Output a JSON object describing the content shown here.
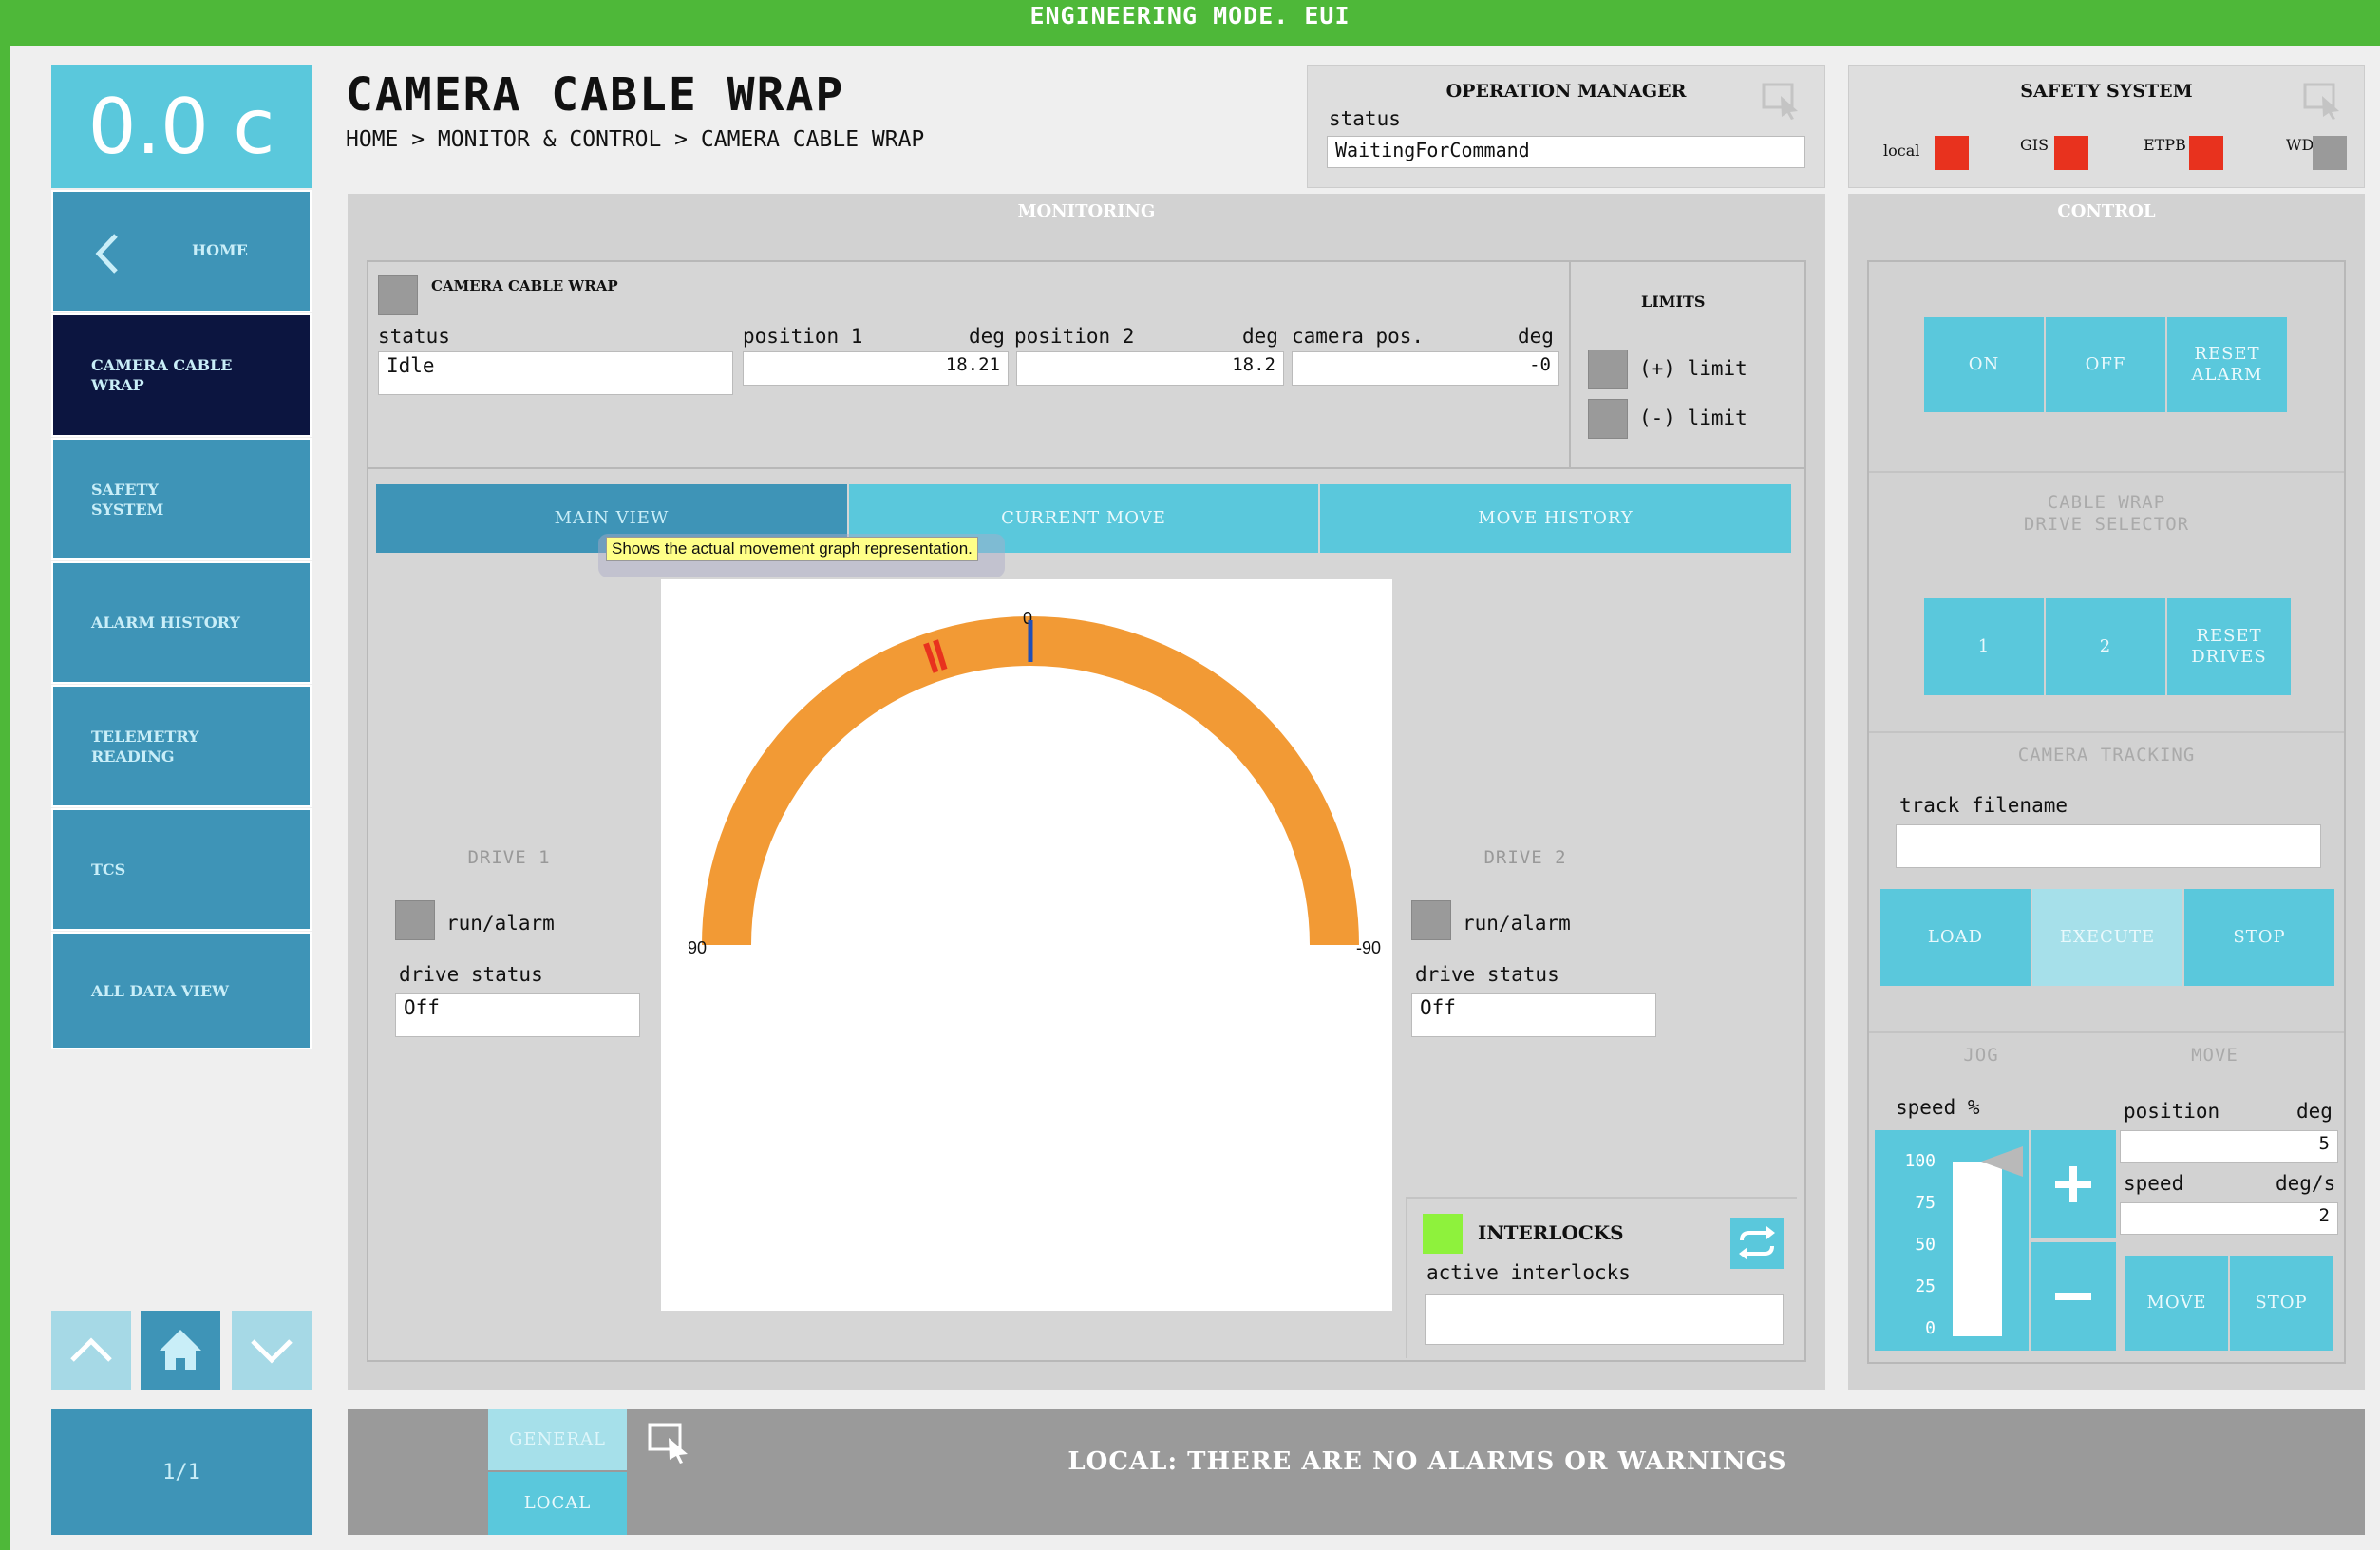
{
  "app": {
    "mode_title": "ENGINEERING MODE. EUI"
  },
  "sidebar": {
    "temperature": "0.0 c",
    "home_label": "HOME",
    "items": [
      {
        "label": "CAMERA CABLE\nWRAP"
      },
      {
        "label": "SAFETY\nSYSTEM"
      },
      {
        "label": "ALARM HISTORY"
      },
      {
        "label": "TELEMETRY\nREADING"
      },
      {
        "label": "TCS"
      },
      {
        "label": "ALL DATA VIEW"
      }
    ],
    "pager": "1/1"
  },
  "header": {
    "title": "CAMERA CABLE WRAP",
    "breadcrumb": "HOME > MONITOR & CONTROL > CAMERA CABLE WRAP"
  },
  "operation_manager": {
    "title": "OPERATION MANAGER",
    "status_label": "status",
    "status_value": "WaitingForCommand"
  },
  "safety_system": {
    "title": "SAFETY SYSTEM",
    "indicators": [
      {
        "label": "local",
        "color": "#e8321e"
      },
      {
        "label": "GIS",
        "color": "#e8321e"
      },
      {
        "label": "ETPB",
        "color": "#e8321e"
      },
      {
        "label": "WD",
        "color": "#9a9a9a"
      }
    ]
  },
  "monitoring": {
    "title": "MONITORING",
    "ccw_title": "CAMERA CABLE WRAP",
    "status_label": "status",
    "status_value": "Idle",
    "position1_label": "position 1",
    "position1_unit": "deg",
    "position1_value": "18.21",
    "position2_label": "position 2",
    "position2_unit": "deg",
    "position2_value": "18.2",
    "camera_pos_label": "camera pos.",
    "camera_pos_unit": "deg",
    "camera_pos_value": "-0",
    "limits_title": "LIMITS",
    "limit_plus": "(+) limit",
    "limit_minus": "(-) limit",
    "tabs": [
      "MAIN VIEW",
      "CURRENT MOVE",
      "MOVE HISTORY"
    ],
    "tooltip": "Shows the actual movement graph representation.",
    "gauge": {
      "label_top": "0",
      "label_left": "90",
      "label_right": "-90",
      "position1_deg": 18.21,
      "position2_deg": 18.2,
      "camera_deg": 0
    },
    "drive1": {
      "title": "DRIVE 1",
      "run_label": "run/alarm",
      "status_label": "drive status",
      "status_value": "Off"
    },
    "drive2": {
      "title": "DRIVE 2",
      "run_label": "run/alarm",
      "status_label": "drive status",
      "status_value": "Off"
    },
    "interlocks": {
      "title": "INTERLOCKS",
      "active_label": "active interlocks",
      "active_value": "",
      "indicator_color": "#8ef23c"
    }
  },
  "control": {
    "title": "CONTROL",
    "power_buttons": [
      "ON",
      "OFF",
      "RESET\nALARM"
    ],
    "drive_selector_title": "CABLE WRAP\nDRIVE SELECTOR",
    "drive_buttons": [
      "1",
      "2",
      "RESET\nDRIVES"
    ],
    "tracking_title": "CAMERA TRACKING",
    "track_filename_label": "track filename",
    "track_filename_value": "",
    "tracking_buttons": [
      "LOAD",
      "EXECUTE",
      "STOP"
    ],
    "jog_title": "JOG",
    "move_title": "MOVE",
    "speed_pct_label": "speed %",
    "slider_ticks": [
      "100",
      "75",
      "50",
      "25",
      "0"
    ],
    "jog_speed_pct": 100,
    "position_label": "position",
    "position_unit": "deg",
    "position_value": "5",
    "speed_label": "speed",
    "speed_unit": "deg/s",
    "speed_value": "2",
    "move_button": "MOVE",
    "stop_button": "STOP"
  },
  "footer": {
    "general_tab": "GENERAL",
    "local_tab": "LOCAL",
    "message": "LOCAL: THERE ARE NO ALARMS OR WARNINGS"
  }
}
